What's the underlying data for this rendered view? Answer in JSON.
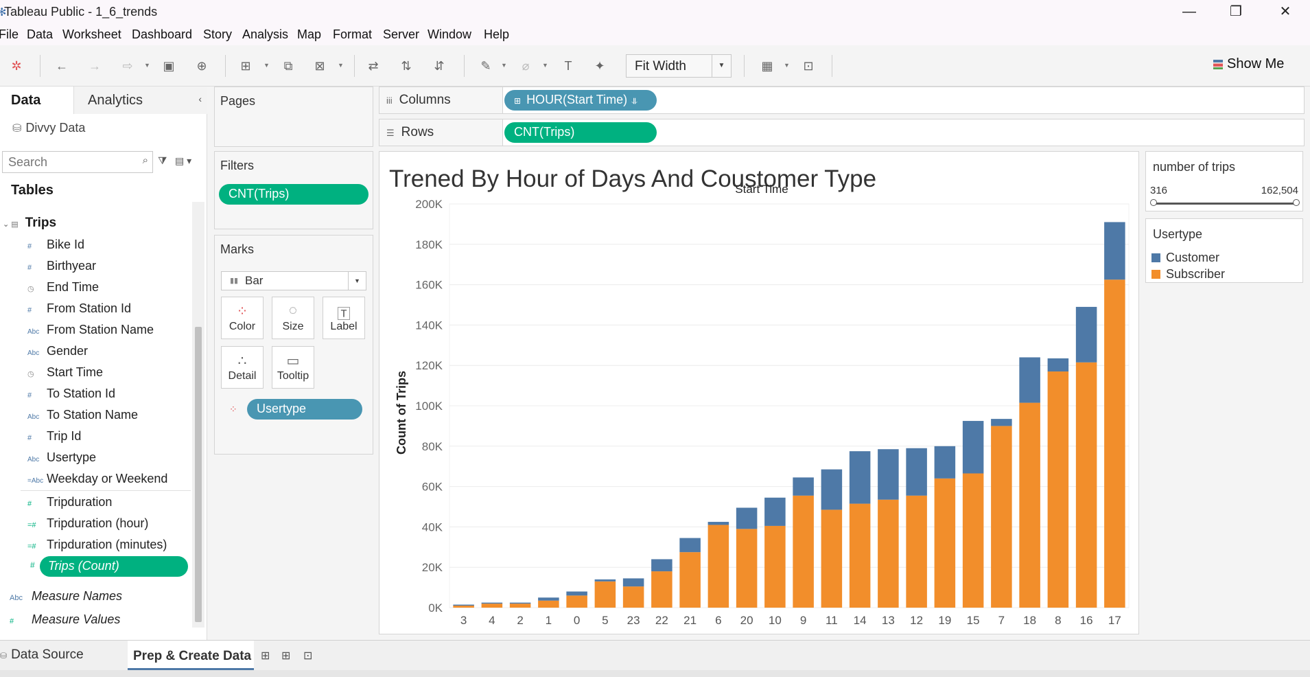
{
  "window": {
    "title": "Tableau Public - 1_6_trends"
  },
  "menu": [
    "File",
    "Data",
    "Worksheet",
    "Dashboard",
    "Story",
    "Analysis",
    "Map",
    "Format",
    "Server",
    "Window",
    "Help"
  ],
  "toolbar": {
    "fit_value": "Fit Width",
    "show_me": "Show Me"
  },
  "data_pane": {
    "tab_data": "Data",
    "tab_analytics": "Analytics",
    "datasource": "Divvy Data",
    "search_placeholder": "Search",
    "tables_heading": "Tables",
    "table_name": "Trips",
    "dimensions": [
      {
        "name": "Bike Id",
        "icon": "number-icon"
      },
      {
        "name": "Birthyear",
        "icon": "number-icon"
      },
      {
        "name": "End Time",
        "icon": "datetime-icon"
      },
      {
        "name": "From Station Id",
        "icon": "number-icon"
      },
      {
        "name": "From Station Name",
        "icon": "abc-icon"
      },
      {
        "name": "Gender",
        "icon": "abc-icon"
      },
      {
        "name": "Start Time",
        "icon": "datetime-icon"
      },
      {
        "name": "To Station Id",
        "icon": "number-icon"
      },
      {
        "name": "To Station Name",
        "icon": "abc-icon"
      },
      {
        "name": "Trip Id",
        "icon": "number-icon"
      },
      {
        "name": "Usertype",
        "icon": "abc-icon"
      },
      {
        "name": "Weekday or Weekend",
        "icon": "calc-abc-icon"
      }
    ],
    "measures": [
      {
        "name": "Tripduration",
        "icon": "number-icon"
      },
      {
        "name": "Tripduration (hour)",
        "icon": "calc-number-icon"
      },
      {
        "name": "Tripduration (minutes)",
        "icon": "calc-number-icon"
      }
    ],
    "selected_measure": "Trips (Count)",
    "measure_names": "Measure Names",
    "measure_values": "Measure Values"
  },
  "cards": {
    "pages": "Pages",
    "filters": "Filters",
    "filter_pill": "CNT(Trips)",
    "marks": "Marks",
    "mark_type": "Bar",
    "mark_buttons": [
      "Color",
      "Size",
      "Label",
      "Detail",
      "Tooltip"
    ],
    "marks_pill": "Usertype"
  },
  "shelves": {
    "columns_label": "Columns",
    "columns_pill": "HOUR(Start Time)",
    "rows_label": "Rows",
    "rows_pill": "CNT(Trips)"
  },
  "viz": {
    "title": "Trened By Hour of Days And Coustomer Type"
  },
  "legend_range": {
    "title": "number of trips",
    "min": "316",
    "max": "162,504"
  },
  "legend_type": {
    "title": "Usertype",
    "items": [
      {
        "name": "Customer",
        "color": "#4e79a7"
      },
      {
        "name": "Subscriber",
        "color": "#f28e2b"
      }
    ]
  },
  "bottom": {
    "datasource_tab": "Data Source",
    "sheet_tab": "Prep & Create Data"
  },
  "colors": {
    "green_pill": "#00b180",
    "blue_pill": "#4996b2",
    "customer": "#4e79a7",
    "subscriber": "#f28e2b"
  },
  "chart_data": {
    "type": "bar",
    "stacked": true,
    "xlabel": "Start Time",
    "ylabel": "Count of Trips",
    "ylim": [
      0,
      200000
    ],
    "yticks": [
      0,
      20000,
      40000,
      60000,
      80000,
      100000,
      120000,
      140000,
      160000,
      180000,
      200000
    ],
    "ytick_labels": [
      "0K",
      "20K",
      "40K",
      "60K",
      "80K",
      "100K",
      "120K",
      "140K",
      "160K",
      "180K",
      "200K"
    ],
    "categories": [
      "3",
      "4",
      "2",
      "1",
      "0",
      "5",
      "23",
      "22",
      "21",
      "6",
      "20",
      "10",
      "9",
      "11",
      "14",
      "13",
      "12",
      "19",
      "15",
      "7",
      "18",
      "8",
      "16",
      "17"
    ],
    "series": [
      {
        "name": "Subscriber",
        "color": "#f28e2b",
        "values": [
          1000,
          2000,
          2000,
          3500,
          6000,
          13000,
          10500,
          18000,
          27500,
          41000,
          39000,
          40500,
          55500,
          48500,
          51500,
          53500,
          55500,
          64000,
          66500,
          90000,
          101500,
          117000,
          121500,
          162500
        ]
      },
      {
        "name": "Customer",
        "color": "#4e79a7",
        "values": [
          500,
          500,
          500,
          1500,
          2000,
          1000,
          4000,
          6000,
          7000,
          1500,
          10500,
          14000,
          9000,
          20000,
          26000,
          25000,
          23500,
          16000,
          26000,
          3500,
          22500,
          6500,
          27500,
          28500
        ]
      }
    ]
  }
}
